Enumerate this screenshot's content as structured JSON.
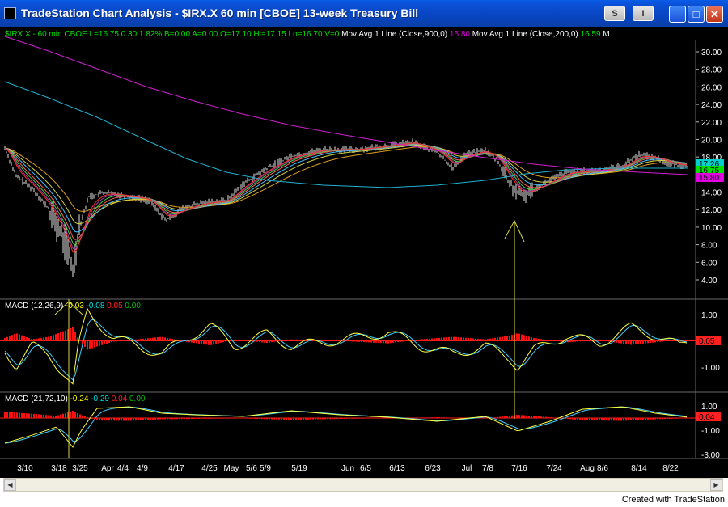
{
  "window": {
    "title": "TradeStation Chart Analysis - $IRX.X  60 min  [CBOE] 13-week Treasury Bill",
    "s_button": "S",
    "i_button": "I",
    "minimize": "_",
    "maximize": "□",
    "close": "✕"
  },
  "header": {
    "segments": [
      {
        "text": "$IRX.X - 60 min  CBOE  L=16.75  0.30  1.82%  B=0.00  A=0.00  O=17.10  Hi=17.15  Lo=16.70  V=0",
        "color": "#00e000"
      },
      {
        "text": "  Mov Avg 1 Line (Close,900,0)",
        "color": "#ffffff"
      },
      {
        "text": "  15.80",
        "color": "#e000e0"
      },
      {
        "text": "  Mov Avg 1 Line (Close,200,0)",
        "color": "#ffffff"
      },
      {
        "text": "  16.59",
        "color": "#00e000"
      },
      {
        "text": "  M",
        "color": "#ffffff"
      }
    ]
  },
  "price_axis": {
    "ticks": [
      "30.00",
      "28.00",
      "26.00",
      "24.00",
      "22.00",
      "20.00",
      "18.00",
      "16.00",
      "14.00",
      "12.00",
      "10.00",
      "8.00",
      "6.00",
      "4.00"
    ]
  },
  "price_labels": [
    {
      "text": "17.26",
      "bg": "#00d0d0",
      "fg": "#000000"
    },
    {
      "text": "16.75",
      "bg": "#00e000",
      "fg": "#000000"
    },
    {
      "text": "15.80",
      "bg": "#e000e0",
      "fg": "#000000"
    }
  ],
  "macd1": {
    "label": "MACD (12,26,9)",
    "values": [
      {
        "text": "-0.03",
        "color": "#ffff00"
      },
      {
        "text": "-0.08",
        "color": "#00e0e0"
      },
      {
        "text": "0.05",
        "color": "#ff2020"
      },
      {
        "text": "0.00",
        "color": "#00c000"
      }
    ],
    "ticks": [
      "1.00",
      "-1.00"
    ],
    "last_label": "0.05"
  },
  "macd2": {
    "label": "MACD (21,72,10)",
    "values": [
      {
        "text": "-0.24",
        "color": "#ffff00"
      },
      {
        "text": "-0.29",
        "color": "#00e0e0"
      },
      {
        "text": "0.04",
        "color": "#ff2020"
      },
      {
        "text": "0.00",
        "color": "#00c000"
      }
    ],
    "ticks": [
      "1.00",
      "-1.00",
      "-3.00"
    ],
    "last_label": "0.04"
  },
  "date_axis": [
    "3/10",
    "3/18",
    "3/25",
    "Apr",
    "4/4",
    "4/9",
    "4/17",
    "4/25",
    "May",
    "5/6",
    "5/9",
    "5/19",
    "Jun",
    "6/5",
    "6/13",
    "6/23",
    "Jul",
    "7/8",
    "7/16",
    "7/24",
    "Aug",
    "8/6",
    "8/14",
    "8/22"
  ],
  "footer": "Created with TradeStation",
  "colors": {
    "ma900": "#d020d0",
    "ma200": "#20b0d0",
    "price": "#e8e8e8",
    "macd": "#ffff40",
    "signal": "#40d0ff",
    "hist": "#ff1010",
    "zero": "#ff2020",
    "arrow": "#d8d840"
  }
}
